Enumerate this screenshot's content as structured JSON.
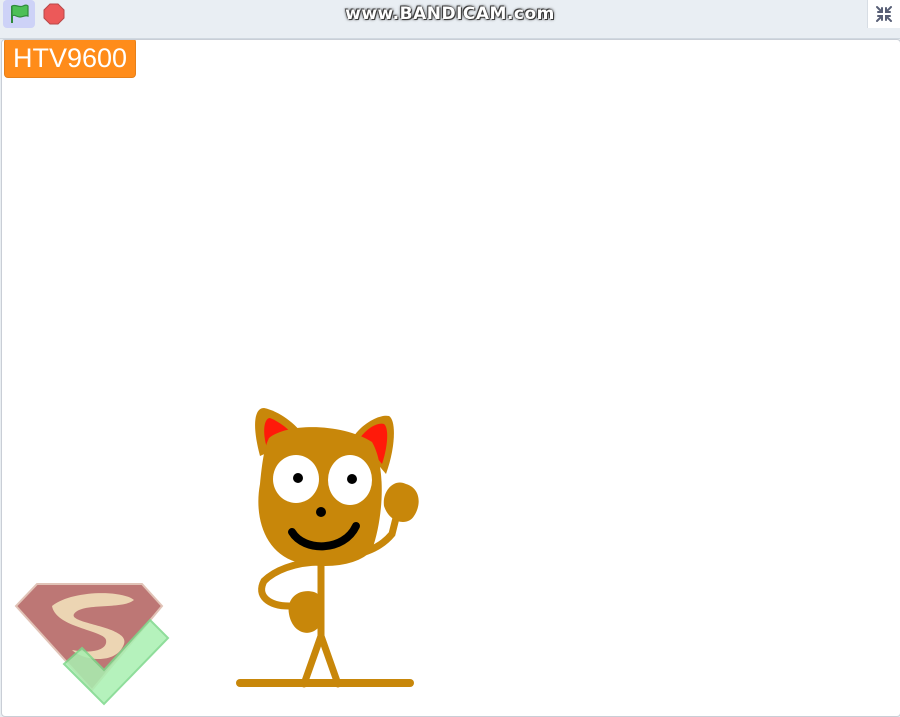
{
  "toolbar": {
    "green_flag_icon": "green-flag-icon",
    "stop_icon": "stop-icon",
    "fullscreen_icon": "fullscreen-icon"
  },
  "watermark": {
    "text": "www.BANDICAM.com"
  },
  "stage": {
    "monitor": {
      "value": "HTV9600"
    }
  },
  "colors": {
    "monitor_orange": "#ff8c1a",
    "flag_green": "#4cbf56",
    "stop_red": "#ec5959",
    "cat_body": "#c8870a",
    "cat_ears": "#ff1a0a"
  }
}
